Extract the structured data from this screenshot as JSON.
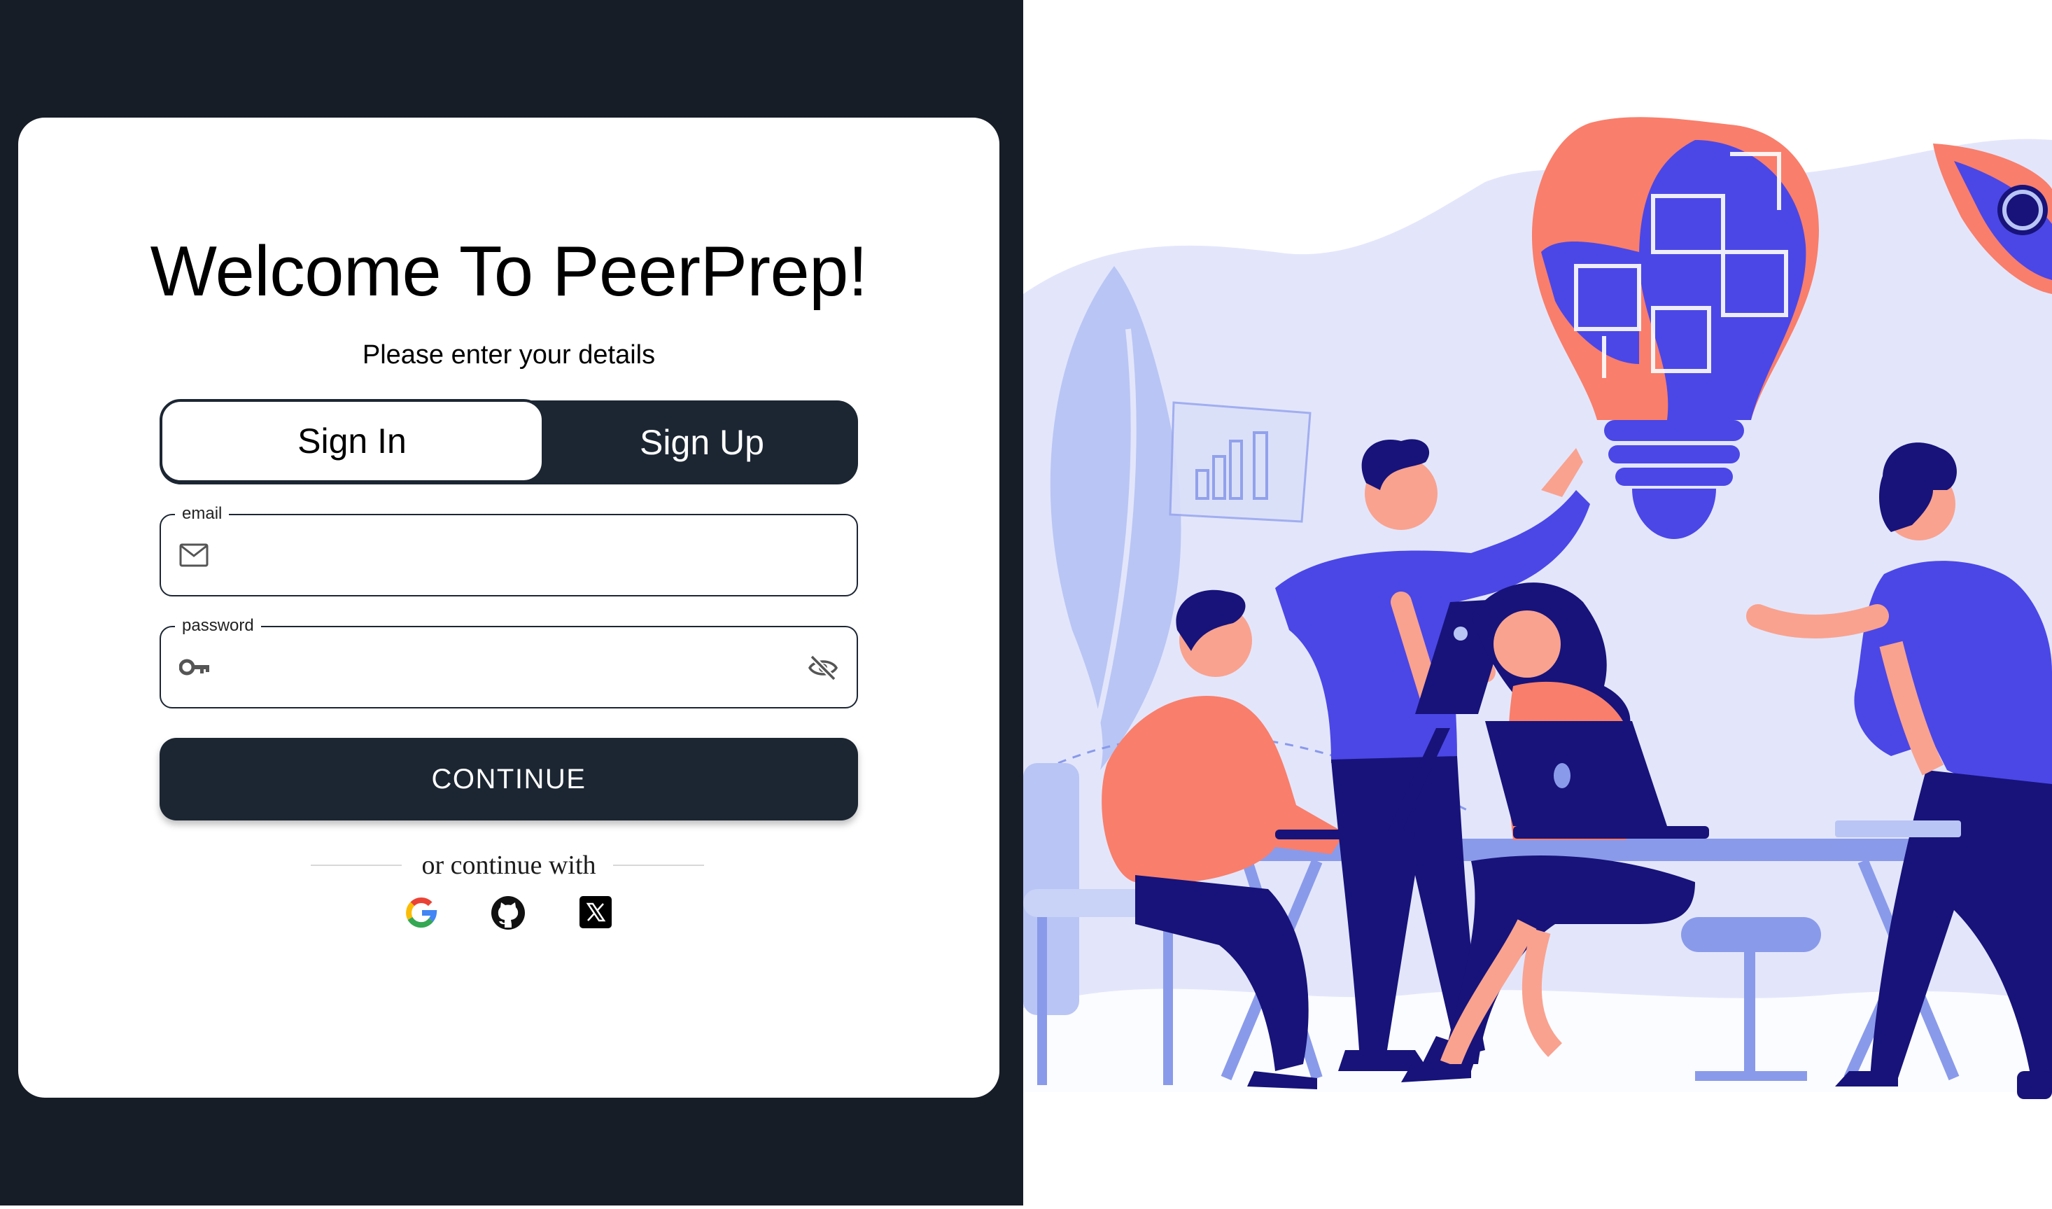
{
  "header": {
    "title": "Welcome To PeerPrep!",
    "subtitle": "Please enter your details"
  },
  "auth_toggle": {
    "active": "Sign In",
    "sign_in_label": "Sign In",
    "sign_up_label": "Sign Up"
  },
  "email_field": {
    "label": "email",
    "value": "",
    "icon": "mail-icon"
  },
  "password_field": {
    "label": "password",
    "value": "",
    "icon": "key-icon",
    "visibility_icon": "eye-off-icon"
  },
  "continue_button": {
    "label": "CONTINUE"
  },
  "social_login": {
    "divider_text": "or continue with",
    "providers": [
      {
        "name": "Google",
        "icon": "google-icon"
      },
      {
        "name": "GitHub",
        "icon": "github-icon"
      },
      {
        "name": "X",
        "icon": "x-icon"
      }
    ]
  },
  "colors": {
    "dark_navy": "#1c2633",
    "page_background": "#161d27",
    "illustration_coral": "#f97e6b",
    "illustration_indigo": "#4b47e6",
    "illustration_navy": "#17137a"
  }
}
